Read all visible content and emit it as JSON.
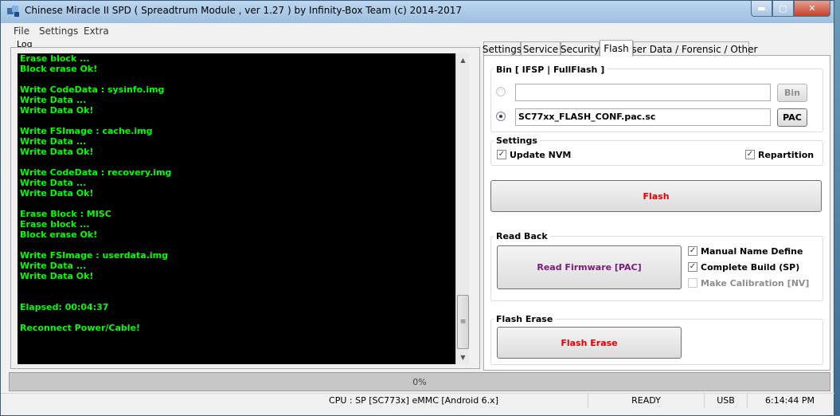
{
  "window": {
    "title": "Chinese Miracle II SPD ( Spreadtrum Module , ver 1.27 ) by Infinity-Box Team (c) 2014-2017",
    "min_glyph": "▬",
    "max_glyph": "▢",
    "close_glyph": "✕"
  },
  "menu": [
    "File",
    "Settings",
    "Extra"
  ],
  "log": {
    "label": "Log",
    "lines": [
      "Erase block ...",
      "Block erase Ok!",
      "",
      "Write CodeData : sysinfo.img",
      "Write Data ...",
      "Write Data Ok!",
      "",
      "Write FSImage : cache.img",
      "Write Data ...",
      "Write Data Ok!",
      "",
      "Write CodeData : recovery.img",
      "Write Data ...",
      "Write Data Ok!",
      "",
      "Erase Block : MISC",
      "Erase block ...",
      "Block erase Ok!",
      "",
      "Write FSImage : userdata.img",
      "Write Data ...",
      "Write Data Ok!",
      "",
      "",
      "Elapsed: 00:04:37",
      "",
      "Reconnect Power/Cable!"
    ]
  },
  "tabs": [
    "Settings",
    "Service",
    "Security",
    "Flash",
    "User Data / Forensic / Other"
  ],
  "flash": {
    "bin_group_title": "Bin  [ IFSP | FullFlash ]",
    "bin_path": "",
    "bin_button": "Bin",
    "pac_path": "SC77xx_FLASH_CONF.pac.sc",
    "pac_button": "PAC",
    "settings_title": "Settings",
    "update_nvm": "Update NVM",
    "repartition": "Repartition",
    "flash_button": "Flash",
    "readback_title": "Read Back",
    "read_firmware_button": "Read Firmware [PAC]",
    "manual_name_define": "Manual Name Define",
    "complete_build": "Complete Build (SP)",
    "make_calibration": "Make Calibration [NV]",
    "flash_erase_title": "Flash Erase",
    "flash_erase_button": "Flash Erase",
    "check_glyph": "✓"
  },
  "progress": "0%",
  "status": {
    "cpu": "CPU : SP [SC773x] eMMC [Android 6.x]",
    "state": "READY",
    "conn": "USB",
    "time": "6:14:44 PM"
  },
  "colors": {
    "log_text": "#00ff00",
    "flash_red": "#e00000",
    "read_purple": "#7a1a7a"
  }
}
